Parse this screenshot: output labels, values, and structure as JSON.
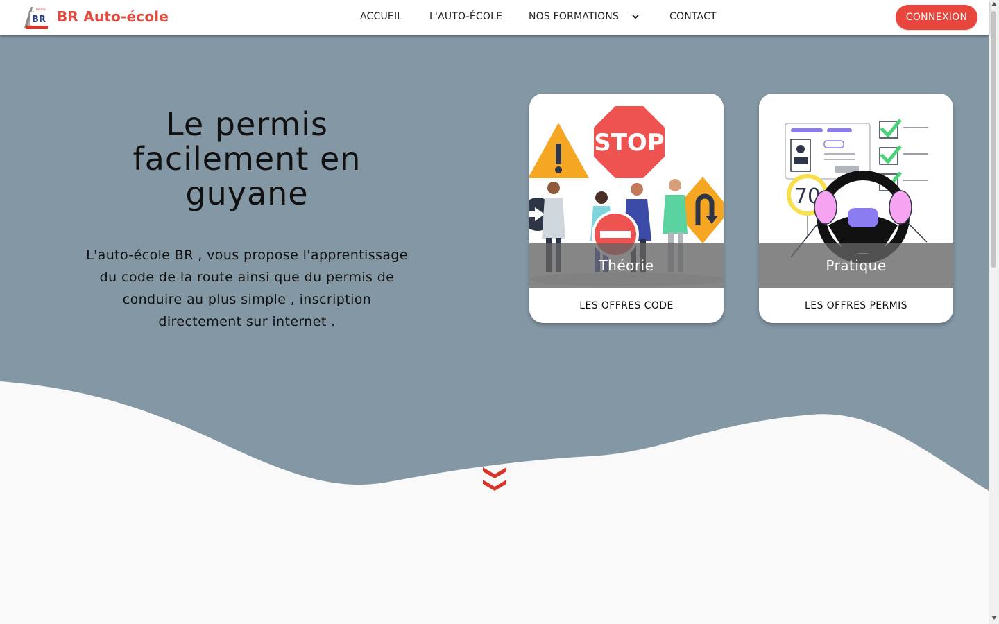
{
  "colors": {
    "brand": "#e04c40",
    "hero_bg": "#8497a5",
    "button": "#e8453c",
    "page_bg": "#f9f9f9"
  },
  "header": {
    "logo_icon": "br-logo-icon",
    "brand_name": "BR Auto-école",
    "nav": {
      "home": "ACCUEIL",
      "school": "L'AUTO-ÉCOLE",
      "formations": "NOS FORMATIONS",
      "contact": "CONTACT"
    },
    "login_button": "CONNEXION"
  },
  "hero": {
    "title": "Le permis facilement en guyane",
    "description": "L'auto-école BR , vous propose l'apprentissage du code de la route ainsi que du permis de conduire au plus simple , inscription directement sur internet ."
  },
  "cards": [
    {
      "caption": "Théorie",
      "link": "LES OFFRES CODE",
      "image_icon": "road-signs-illustration",
      "sign_text": "STOP"
    },
    {
      "caption": "Pratique",
      "link": "LES OFFRES PERMIS",
      "image_icon": "driving-license-illustration",
      "sign_text": "70"
    }
  ],
  "scroll_icon": "double-chevron-down-icon"
}
